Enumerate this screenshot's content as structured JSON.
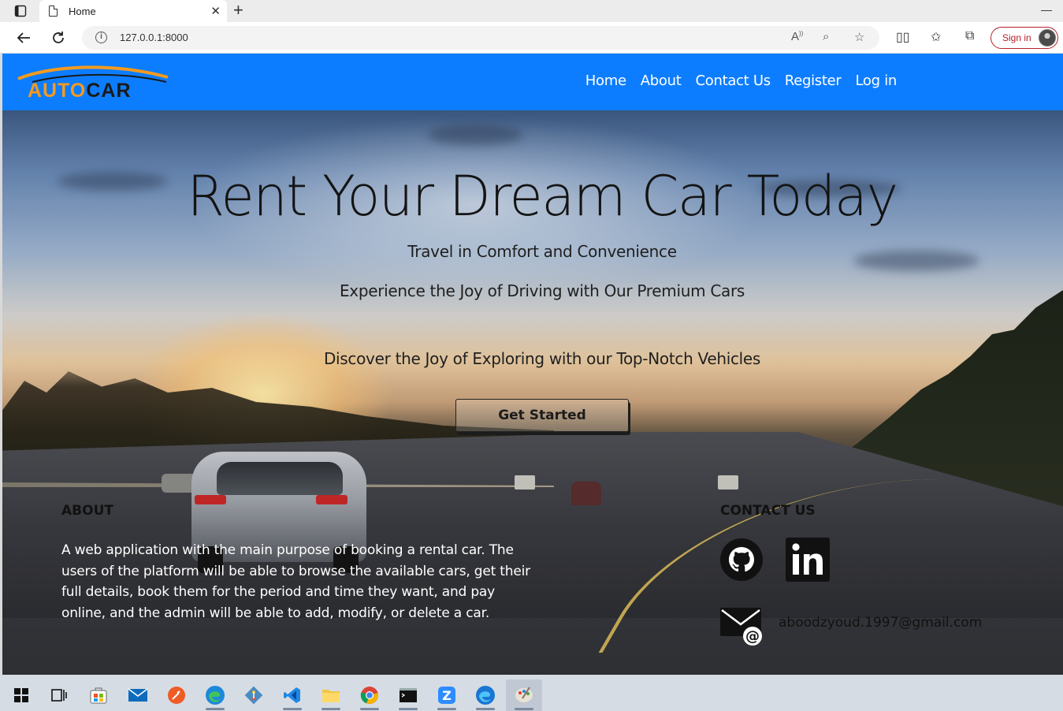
{
  "browser": {
    "tab_title": "Home",
    "url": "127.0.0.1:8000",
    "signin_label": "Sign in"
  },
  "site": {
    "logo": {
      "part1": "AUTO",
      "part2": "CAR"
    },
    "nav": [
      "Home",
      "About",
      "Contact Us",
      "Register",
      "Log in"
    ]
  },
  "hero": {
    "title": "Rent Your Dream Car Today",
    "line1": "Travel in Comfort and Convenience",
    "line2": "Experience the Joy of Driving with Our Premium Cars",
    "line3": "Discover the Joy of Exploring with our Top-Notch Vehicles",
    "cta": "Get Started"
  },
  "about": {
    "heading": "ABOUT",
    "text": "A web application with the main purpose of booking a rental car. The users of the platform will be able to browse the available cars, get their full details, book them for the period and time they want, and pay online, and the admin will be able to add, modify, or delete a car."
  },
  "contact": {
    "heading": "CONTACT US",
    "email": "aboodzyoud.1997@gmail.com",
    "icons": [
      "github-icon",
      "linkedin-icon",
      "email-icon"
    ]
  },
  "colors": {
    "navbar": "#0d7dff",
    "logo_accent": "#f39a1e",
    "signin": "#b9202a"
  },
  "taskbar": {
    "icons": [
      "start-icon",
      "task-view-icon",
      "store-icon",
      "mail-icon",
      "postman-icon",
      "edge-icon",
      "git-icon",
      "vscode-icon",
      "file-explorer-icon",
      "chrome-icon",
      "terminal-icon",
      "zoom-icon",
      "edge-dev-icon",
      "paint-icon"
    ]
  }
}
